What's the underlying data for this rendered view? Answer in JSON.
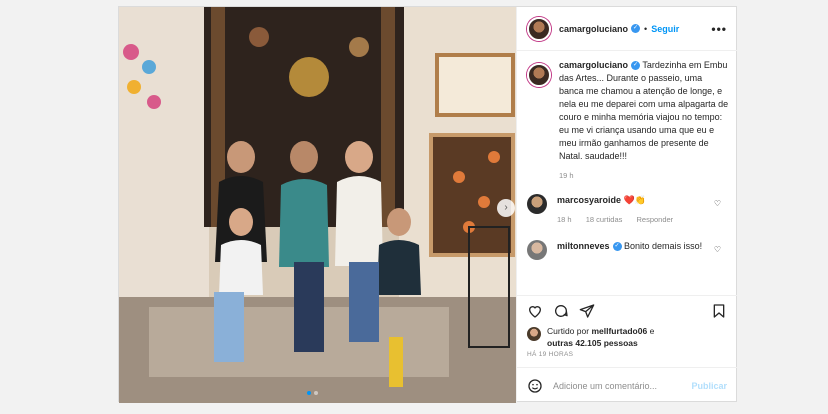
{
  "post": {
    "username": "camargoluciano",
    "follow_label": "Seguir",
    "more_label": "•••",
    "caption_user": "camargoluciano",
    "caption_text": "Tardezinha em Embu das Artes... Durante o passeio, uma banca me chamou a atenção de longe, e nela eu me deparei com uma alpagarta de couro e minha memória viajou no tempo: eu me vi criança usando uma que eu e meu irmão ganhamos de presente de Natal. saudade!!!",
    "caption_time": "19 h"
  },
  "comments": [
    {
      "user": "marcosyaroide",
      "text": "❤️👏",
      "time": "18 h",
      "likes": "18 curtidas",
      "reply": "Responder"
    },
    {
      "user": "miltonneves",
      "text": "Bonito demais isso!"
    }
  ],
  "likes": {
    "prefix": "Curtido por",
    "user": "mellfurtado06",
    "suffix": "e",
    "others": "outras 42.105 pessoas"
  },
  "time_ago": "HÁ 19 HORAS",
  "add_comment": {
    "placeholder": "Adicione um comentário...",
    "publish_label": "Publicar"
  },
  "colors": {
    "accent": "#0095f6",
    "verified": "#3897f0",
    "publish_disabled": "#b2dffc"
  },
  "icons": [
    "heart-icon",
    "comment-icon",
    "share-icon",
    "bookmark-icon",
    "emoji-icon",
    "more-icon",
    "verified-icon",
    "chevron-right-icon"
  ]
}
